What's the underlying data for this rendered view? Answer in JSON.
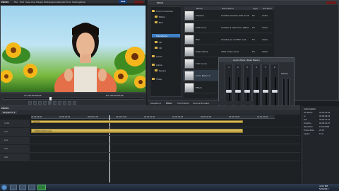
{
  "app": {
    "name": "EDIUS",
    "menu": [
      "File",
      "Edit",
      "View",
      "Clip",
      "Marker",
      "Mode",
      "Capture",
      "Render",
      "Tools",
      "Settings",
      "Help"
    ],
    "mode_badge": "PLR"
  },
  "player": {
    "timecode_left": "Cur 00:00:06;03",
    "timecode_right": "Dur 00:00:00;00"
  },
  "bin": {
    "title": "EDIUS",
    "folders": [
      "Video Effects",
      "Color Correction",
      "Blur",
      "Key",
      "Transitions",
      "Audio Effects",
      "Titles"
    ],
    "tree_items": [
      "Color Correction",
      "Filters",
      "Blur",
      "Transitions",
      "2D",
      "3D",
      "Audio",
      "Alpha",
      "Keyers",
      "Titles"
    ],
    "columns": [
      "Name",
      "Description",
      "Type",
      "Duration"
    ],
    "rows": [
      {
        "name": "Shadow",
        "desc": "Creates shadow with border",
        "type": "FX",
        "dur": "Video"
      },
      {
        "name": "Soft Focus",
        "desc": "Creates a soft focus effect",
        "type": "FX",
        "dur": "Video"
      },
      {
        "name": "Film",
        "desc": "Creates an old film look",
        "type": "FX",
        "dur": "Video"
      },
      {
        "name": "Video Noise",
        "desc": "Adds video noise",
        "type": "FX",
        "dur": "Video"
      },
      {
        "name": "YUV Curve",
        "desc": "Color adjustment curves",
        "type": "FX",
        "dur": "Video"
      },
      {
        "name": "Color Balance",
        "desc": "Adjusts color balance",
        "type": "FX",
        "dur": "Video"
      },
      {
        "name": "Effect",
        "desc": "",
        "type": "FX",
        "dur": "Video"
      }
    ],
    "tabs": [
      "Sequence",
      "Effect",
      "Information",
      "Source Browser"
    ]
  },
  "mixer": {
    "title": "Audio Mixer (Peak Meter)",
    "channels": [
      "1",
      "2",
      "3",
      "4",
      "5",
      "6"
    ],
    "master_label": "Master"
  },
  "timeline": {
    "title": "EDIUS",
    "sequence_tab": "Sequence 1",
    "ruler": [
      "00:00:00;00",
      "00:00:05;00",
      "00:00:10;00",
      "00:00:15;00",
      "00:00:20;00",
      "00:00:25;00",
      "00:00:30;00",
      "00:00:35;00",
      "00:00:40;00"
    ],
    "tracks": [
      "1 VA",
      "1 A",
      "2 A",
      "3 A",
      "4 A"
    ],
    "clips": [
      {
        "label": "Leading"
      },
      {
        "label": "Bright Outdoors (A)"
      }
    ]
  },
  "info": {
    "title": "Information",
    "rows": [
      "File Name",
      "In",
      "Out",
      "Duration",
      "Resolution",
      "Frame Rate",
      "Aspect"
    ],
    "values": [
      "00:00:04;05",
      "00:00:06;03",
      "00:00:07;12",
      "00:00:01;07",
      "1920x1080",
      "29.97",
      "16:9"
    ]
  },
  "taskbar": {
    "time": "4:43 PM",
    "date": "5/3/2013"
  },
  "colors": {
    "accent": "#3f7fc4",
    "clip": "#d9c677",
    "panel": "#2a2d31"
  }
}
